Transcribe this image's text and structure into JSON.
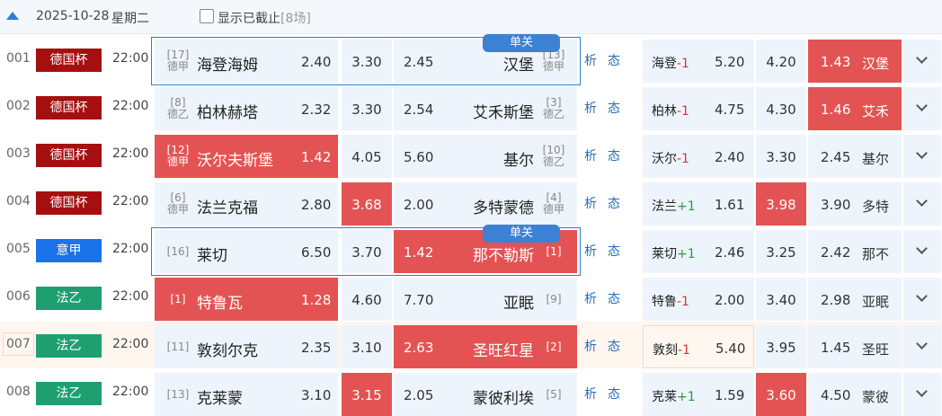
{
  "header": {
    "date": "2025-10-28",
    "weekday": "星期二",
    "show_closed_label": "显示已截止",
    "show_closed_count": "[8场]"
  },
  "colors": {
    "dfb": "#a50f0f",
    "seriea": "#1a73e8",
    "ligue2": "#1f9f6f",
    "highlight": "#e45353",
    "accent": "#2a7fd4"
  },
  "links": {
    "analysis": "析",
    "status": "态"
  },
  "single_tag": "单关",
  "matches": [
    {
      "num": "001",
      "league": "德国杯",
      "color": "dfb",
      "time": "22:00",
      "home_rank": "[17]",
      "home_league": "德甲",
      "home": "海登海姆",
      "h": "2.40",
      "d": "3.30",
      "a": "2.45",
      "away": "汉堡",
      "away_rank": "[13]",
      "away_league": "德甲",
      "hcp_team": "海登",
      "hcp": "-1",
      "hcp_sign": "neg",
      "hh": "5.20",
      "hd": "4.20",
      "ha": "1.43",
      "hcp_away": "汉堡"
    },
    {
      "num": "002",
      "league": "德国杯",
      "color": "dfb",
      "time": "22:00",
      "home_rank": "[8]",
      "home_league": "德乙",
      "home": "柏林赫塔",
      "h": "2.32",
      "d": "3.30",
      "a": "2.54",
      "away": "艾禾斯堡",
      "away_rank": "[3]",
      "away_league": "德乙",
      "hcp_team": "柏林",
      "hcp": "-1",
      "hcp_sign": "neg",
      "hh": "4.75",
      "hd": "4.30",
      "ha": "1.46",
      "hcp_away": "艾禾"
    },
    {
      "num": "003",
      "league": "德国杯",
      "color": "dfb",
      "time": "22:00",
      "home_rank": "[12]",
      "home_league": "德甲",
      "home": "沃尔夫斯堡",
      "h": "1.42",
      "d": "4.05",
      "a": "5.60",
      "away": "基尔",
      "away_rank": "[10]",
      "away_league": "德乙",
      "hcp_team": "沃尔",
      "hcp": "-1",
      "hcp_sign": "neg",
      "hh": "2.40",
      "hd": "3.30",
      "ha": "2.45",
      "hcp_away": "基尔"
    },
    {
      "num": "004",
      "league": "德国杯",
      "color": "dfb",
      "time": "22:00",
      "home_rank": "[6]",
      "home_league": "德甲",
      "home": "法兰克福",
      "h": "2.80",
      "d": "3.68",
      "a": "2.00",
      "away": "多特蒙德",
      "away_rank": "[4]",
      "away_league": "德甲",
      "hcp_team": "法兰",
      "hcp": "+1",
      "hcp_sign": "pos",
      "hh": "1.61",
      "hd": "3.98",
      "ha": "3.90",
      "hcp_away": "多特"
    },
    {
      "num": "005",
      "league": "意甲",
      "color": "seriea",
      "time": "22:00",
      "home_rank": "[16]",
      "home_league": "",
      "home": "莱切",
      "h": "6.50",
      "d": "3.70",
      "a": "1.42",
      "away": "那不勒斯",
      "away_rank": "[1]",
      "away_league": "",
      "hcp_team": "莱切",
      "hcp": "+1",
      "hcp_sign": "pos",
      "hh": "2.46",
      "hd": "3.25",
      "ha": "2.42",
      "hcp_away": "那不"
    },
    {
      "num": "006",
      "league": "法乙",
      "color": "ligue2",
      "time": "22:00",
      "home_rank": "[1]",
      "home_league": "",
      "home": "特鲁瓦",
      "h": "1.28",
      "d": "4.60",
      "a": "7.70",
      "away": "亚眠",
      "away_rank": "[9]",
      "away_league": "",
      "hcp_team": "特鲁",
      "hcp": "-1",
      "hcp_sign": "neg",
      "hh": "2.00",
      "hd": "3.40",
      "ha": "2.98",
      "hcp_away": "亚眠"
    },
    {
      "num": "007",
      "league": "法乙",
      "color": "ligue2",
      "time": "22:00",
      "home_rank": "[11]",
      "home_league": "",
      "home": "敦刻尔克",
      "h": "2.35",
      "d": "3.10",
      "a": "2.63",
      "away": "圣旺红星",
      "away_rank": "[2]",
      "away_league": "",
      "hcp_team": "敦刻",
      "hcp": "-1",
      "hcp_sign": "neg",
      "hh": "5.40",
      "hd": "3.95",
      "ha": "1.45",
      "hcp_away": "圣旺"
    },
    {
      "num": "008",
      "league": "法乙",
      "color": "ligue2",
      "time": "22:00",
      "home_rank": "[13]",
      "home_league": "",
      "home": "克莱蒙",
      "h": "3.10",
      "d": "3.15",
      "a": "2.05",
      "away": "蒙彼利埃",
      "away_rank": "[5]",
      "away_league": "",
      "hcp_team": "克莱",
      "hcp": "+1",
      "hcp_sign": "pos",
      "hh": "1.59",
      "hd": "3.60",
      "ha": "4.50",
      "hcp_away": "蒙彼"
    }
  ]
}
